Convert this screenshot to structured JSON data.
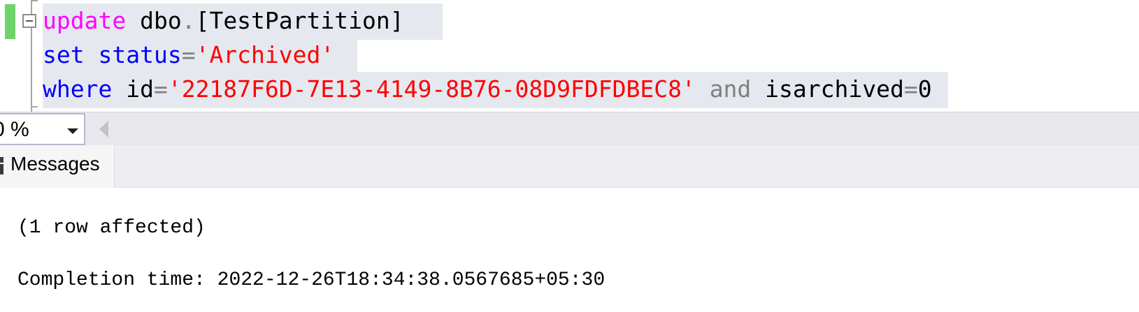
{
  "editor": {
    "lines": [
      {
        "tokens": [
          {
            "text": "update",
            "role": "keyword"
          },
          {
            "text": " dbo",
            "role": "identifier"
          },
          {
            "text": ".",
            "role": "operator"
          },
          {
            "text": "[TestPartition]",
            "role": "identifier"
          }
        ]
      },
      {
        "tokens": [
          {
            "text": "set",
            "role": "keyword"
          },
          {
            "text": " ",
            "role": "space"
          },
          {
            "text": "status",
            "role": "keyword"
          },
          {
            "text": "=",
            "role": "operator"
          },
          {
            "text": "'Archived'",
            "role": "string"
          }
        ]
      },
      {
        "tokens": [
          {
            "text": "where",
            "role": "keyword"
          },
          {
            "text": " id",
            "role": "identifier"
          },
          {
            "text": "=",
            "role": "operator"
          },
          {
            "text": "'22187F6D-7E13-4149-8B76-08D9FDFDBEC8'",
            "role": "string"
          },
          {
            "text": " ",
            "role": "space"
          },
          {
            "text": "and",
            "role": "operator"
          },
          {
            "text": " isarchived",
            "role": "identifier"
          },
          {
            "text": "=",
            "role": "operator"
          },
          {
            "text": "0",
            "role": "identifier"
          }
        ]
      }
    ]
  },
  "zoom": {
    "value": "0 %"
  },
  "results": {
    "tab_label": "Messages",
    "messages": [
      "(1 row affected)",
      "Completion time: 2022-12-26T18:34:38.0567685+05:30"
    ]
  },
  "colors": {
    "keyword_magenta": "#ff00ff",
    "keyword_blue": "#0000ff",
    "string": "#ff0000",
    "operator": "#808080",
    "selection": "#e6e8ef",
    "change_marker": "#6fd36b"
  },
  "icons": {
    "collapse": "collapse-minus-icon",
    "dropdown": "chevron-down-icon",
    "scroll_left": "scroll-left-arrow-icon",
    "messages": "messages-icon"
  }
}
